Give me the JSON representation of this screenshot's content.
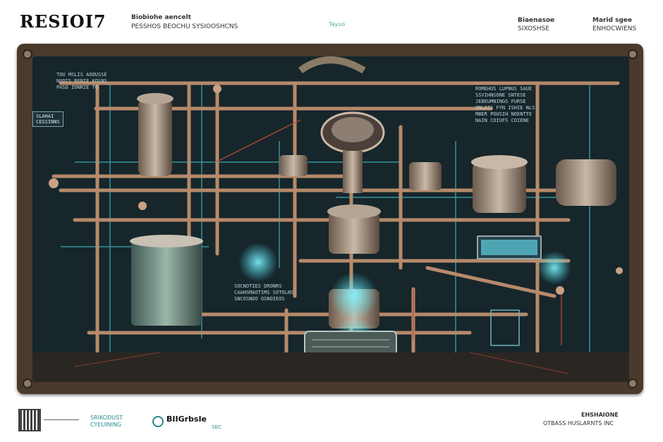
{
  "header": {
    "logo": "RESIOI7",
    "line1": "Biobiohe aencelt",
    "line2": "PESSHOS BEOCHU SYSIOOSHCNS",
    "mid": "Tayuo",
    "right1": "Biaenasoe",
    "right2": "SIXOSHSE",
    "right3": "Marid sgee",
    "right4": "ENHOCWIENS"
  },
  "screen": {
    "text_block_1": [
      "TOU MSLIS AOOUSSE",
      "NUOIS RENIE KOSNS",
      "PASO IONRIE TO"
    ],
    "tag_left": [
      "SLAHAI",
      "CESSINNS"
    ],
    "text_block_right": [
      "ROMEHUS LUPNUS SAUE",
      "SSVIHNSONE SNTESE",
      "JEBEUMNINGS FURSE",
      "ONLOIS FYN ISHIE NLS",
      "MBER POUSIH NOENTTE",
      "NAIN COIUFS COIENE"
    ],
    "text_block_low": [
      "SOCNOTIES DRONRS",
      "CAAHSMAOTIMS SOTOLNS",
      "SNCOSNOO OSNOIEOS"
    ]
  },
  "footer": {
    "left1": "SRIKODUST",
    "left2": "CYEUINING",
    "brand": "BIIGrbsIe",
    "brand2": "SEC",
    "right1": "EHSHAIONE",
    "right2": "OTBASS HUSLARNTS INC"
  },
  "colors": {
    "pipe": "#b68a6a",
    "glow": "#4fe0f0",
    "panel": "#4a3a2c",
    "screen": "#16262b"
  }
}
